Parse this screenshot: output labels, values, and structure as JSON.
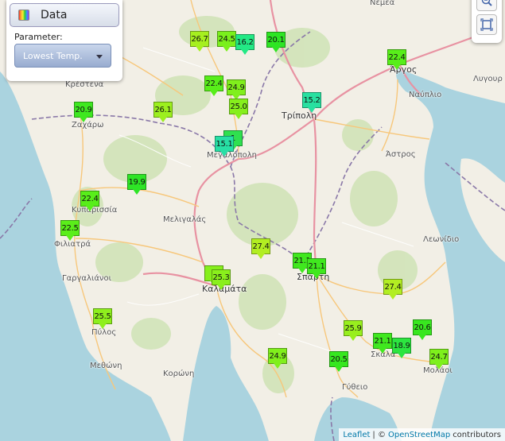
{
  "control": {
    "title": "Data",
    "parameter_label": "Parameter:",
    "selected_parameter": "Lowest Temp."
  },
  "places": [
    {
      "name": "Νεμέα",
      "big": false
    },
    {
      "name": "Κρέστενα",
      "big": false
    },
    {
      "name": "Ζαχάρω",
      "big": false
    },
    {
      "name": "Τρίπολη",
      "big": true
    },
    {
      "name": "Άργος",
      "big": true
    },
    {
      "name": "Ναύπλιο",
      "big": false
    },
    {
      "name": "Λυγουρ",
      "big": false
    },
    {
      "name": "Μεγαλόπολη",
      "big": false
    },
    {
      "name": "Άστρος",
      "big": false
    },
    {
      "name": "Κυπαρισσία",
      "big": false
    },
    {
      "name": "Μελιγαλάς",
      "big": false
    },
    {
      "name": "Φιλιατρά",
      "big": false
    },
    {
      "name": "Λεωνίδιο",
      "big": false
    },
    {
      "name": "Σπάρτη",
      "big": true
    },
    {
      "name": "Γαργαλιάνοι",
      "big": false
    },
    {
      "name": "Καλαμάτα",
      "big": true
    },
    {
      "name": "Πύλος",
      "big": false
    },
    {
      "name": "Μεθώνη",
      "big": false
    },
    {
      "name": "Κορώνη",
      "big": false
    },
    {
      "name": "Σκάλα",
      "big": false
    },
    {
      "name": "Μολάοι",
      "big": false
    },
    {
      "name": "Γύθειο",
      "big": false
    }
  ],
  "markers": [
    {
      "value": "26.7",
      "color": "#a6ef1f"
    },
    {
      "value": "24.5",
      "color": "#7af01c"
    },
    {
      "value": "16.2",
      "color": "#23e985"
    },
    {
      "value": "20.1",
      "color": "#2ee523"
    },
    {
      "value": "22.4",
      "color": "#58ee1a"
    },
    {
      "value": "22.4",
      "color": "#58ee1a"
    },
    {
      "value": "24.9",
      "color": "#80ef1c"
    },
    {
      "value": "25.0",
      "color": "#86ef1c"
    },
    {
      "value": "20.9",
      "color": "#3ee820"
    },
    {
      "value": "26.1",
      "color": "#9cef1e"
    },
    {
      "value": "15.2",
      "color": "#28e0a0"
    },
    {
      "value": "15.1",
      "color": "#28dfa5"
    },
    {
      "value": "1",
      "color": "#2fe04f"
    },
    {
      "value": "19.9",
      "color": "#2ee526"
    },
    {
      "value": "22.4",
      "color": "#58ee1a"
    },
    {
      "value": "22.5",
      "color": "#5aee1a"
    },
    {
      "value": "27.4",
      "color": "#b2ee22"
    },
    {
      "value": "21.1",
      "color": "#40e81f"
    },
    {
      "value": "21.1",
      "color": "#40e81f"
    },
    {
      "value": "2",
      "color": "#86ef1c"
    },
    {
      "value": "25.3",
      "color": "#8aef1c"
    },
    {
      "value": "27.4",
      "color": "#b2ee22"
    },
    {
      "value": "25.5",
      "color": "#8eef1d"
    },
    {
      "value": "25.9",
      "color": "#98ef1e"
    },
    {
      "value": "20.6",
      "color": "#38e71f"
    },
    {
      "value": "21.1",
      "color": "#40e81f"
    },
    {
      "value": "18.9",
      "color": "#2ce540"
    },
    {
      "value": "24.7",
      "color": "#7ef01c"
    },
    {
      "value": "24.9",
      "color": "#80ef1c"
    },
    {
      "value": "20.5",
      "color": "#36e71f"
    }
  ],
  "attribution": {
    "leaflet": "Leaflet",
    "separator": "| ©",
    "osm": "OpenStreetMap",
    "suffix": "contributors"
  },
  "colors": {
    "land": "#f2efe6",
    "sea": "#aad3df",
    "forest": "#cfe3b5",
    "road_major": "#e892a2",
    "road_minor": "#f7c77b",
    "border": "#8a78a8"
  }
}
